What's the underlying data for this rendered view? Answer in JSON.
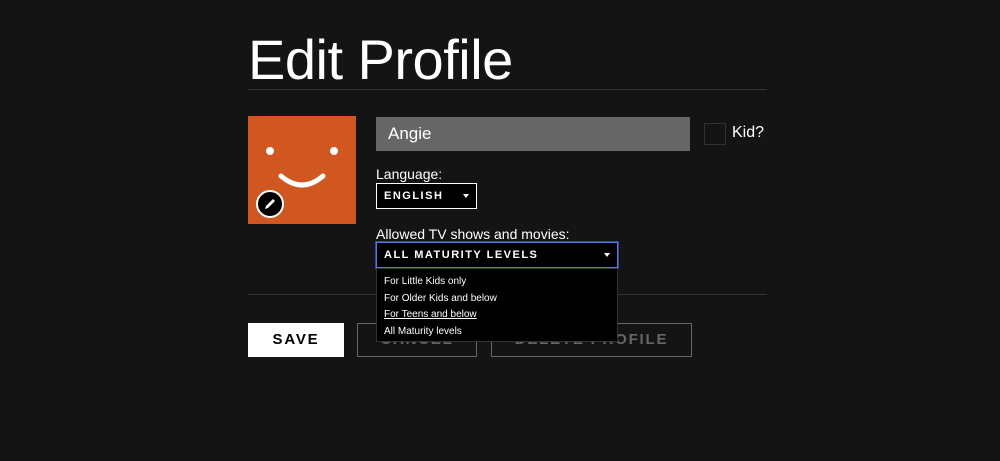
{
  "page": {
    "title": "Edit Profile"
  },
  "profile": {
    "name_value": "Angie",
    "kid_label": "Kid?",
    "avatar_color": "#d0571f",
    "avatar_icon": "smiley-face-icon",
    "edit_icon": "pencil-icon"
  },
  "language": {
    "label": "Language:",
    "selected": "ENGLISH"
  },
  "maturity": {
    "label": "Allowed TV shows and movies:",
    "selected": "ALL MATURITY LEVELS",
    "options": [
      "For Little Kids only",
      "For Older Kids and below",
      "For Teens and below",
      "All Maturity levels"
    ]
  },
  "actions": {
    "save_label": "SAVE",
    "cancel_label": "CANCEL",
    "delete_label": "DELETE PROFILE"
  }
}
